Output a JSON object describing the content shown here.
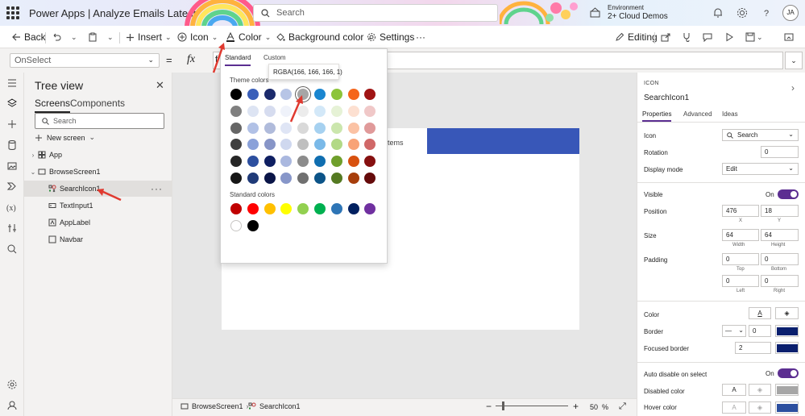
{
  "topbar": {
    "app_name": "Power Apps",
    "separator": "|",
    "doc_title": "Analyze Emails Latest",
    "search_placeholder": "Search",
    "environment_label": "Environment",
    "environment_value": "2+ Cloud Demos",
    "avatar_initials": "JA"
  },
  "commandbar": {
    "back": "Back",
    "insert": "Insert",
    "icon": "Icon",
    "color": "Color",
    "background_color": "Background color",
    "settings": "Settings",
    "more": "···",
    "editing": "Editing"
  },
  "formulabar": {
    "property": "OnSelect",
    "equals": "=",
    "fx": "fx",
    "formula_text": "f"
  },
  "treeview": {
    "title": "Tree view",
    "tabs": [
      "Screens",
      "Components"
    ],
    "search_placeholder": "Search",
    "new_screen": "New screen",
    "items": [
      {
        "label": "App"
      },
      {
        "label": "BrowseScreen1"
      },
      {
        "label": "SearchIcon1"
      },
      {
        "label": "TextInput1"
      },
      {
        "label": "AppLabel"
      },
      {
        "label": "Navbar"
      }
    ],
    "more": "···"
  },
  "canvas": {
    "items_text": "tems"
  },
  "color_popup": {
    "tab_standard": "Standard",
    "tab_custom": "Custom",
    "tooltip": "RGBA(166, 166, 166, 1)",
    "theme_label": "Theme colors",
    "standard_label": "Standard colors",
    "theme_colors": [
      [
        "#000000",
        "#3a5fb9",
        "#1b2a6b",
        "#b7c5e6",
        "#a6a6a6",
        "#1a86d0",
        "#8cc43a",
        "#f5651b",
        "#a01414"
      ],
      [
        "#808080",
        "#dde4f3",
        "#d6dcef",
        "#eff2fa",
        "#ececec",
        "#d3e8f8",
        "#e6f2d6",
        "#fde0d1",
        "#f0c8c8"
      ],
      [
        "#666666",
        "#b1c1e6",
        "#b0bbdb",
        "#dfe5f5",
        "#d9d9d9",
        "#a6d1f0",
        "#cbe6ad",
        "#fbc2a4",
        "#e09a9a"
      ],
      [
        "#404040",
        "#8aa1d9",
        "#8795c7",
        "#cfd8ef",
        "#bfbfbf",
        "#7ab9e8",
        "#b2d986",
        "#f8a377",
        "#d06868"
      ],
      [
        "#262626",
        "#2c4f9f",
        "#0f1f62",
        "#aab8df",
        "#8c8c8c",
        "#106eb0",
        "#6f9f2c",
        "#d8510f",
        "#861010"
      ],
      [
        "#171717",
        "#1f3a78",
        "#0a1547",
        "#8796c9",
        "#707070",
        "#0c5488",
        "#557a22",
        "#a73e0b",
        "#650b0b"
      ]
    ],
    "standard_colors": [
      [
        "#c00000",
        "#ff0000",
        "#ffc000",
        "#ffff00",
        "#92d050",
        "#00b050",
        "#2e75b6",
        "#002060",
        "#7030a0"
      ],
      [
        "#ffffff",
        "#000000"
      ]
    ]
  },
  "statusbar": {
    "screen": "BrowseScreen1",
    "control": "SearchIcon1",
    "zoom_minus": "−",
    "zoom_plus": "+",
    "zoom_value": "50",
    "zoom_unit": "%"
  },
  "properties": {
    "kind": "ICON",
    "name": "SearchIcon1",
    "tabs": [
      "Properties",
      "Advanced",
      "Ideas"
    ],
    "icon_label": "Icon",
    "icon_value": "Search",
    "rotation_label": "Rotation",
    "rotation_value": "0",
    "display_mode_label": "Display mode",
    "display_mode_value": "Edit",
    "visible_label": "Visible",
    "visible_state": "On",
    "position_label": "Position",
    "position_x": "476",
    "position_y": "18",
    "x_label": "X",
    "y_label": "Y",
    "size_label": "Size",
    "size_w": "64",
    "size_h": "64",
    "width_label": "Width",
    "height_label": "Height",
    "padding_label": "Padding",
    "padding_top": "0",
    "padding_bottom": "0",
    "padding_left": "0",
    "padding_right": "0",
    "top_label": "Top",
    "bottom_label": "Bottom",
    "left_label": "Left",
    "right_label": "Right",
    "color_label": "Color",
    "color_glyph": "A",
    "border_label": "Border",
    "border_width": "0",
    "focused_border_label": "Focused border",
    "focused_border_width": "2",
    "auto_disable_label": "Auto disable on select",
    "auto_disable_state": "On",
    "disabled_color_label": "Disabled color",
    "hover_color_label": "Hover color",
    "colors": {
      "border_swatch": "#0a1f6e",
      "focused_swatch": "#0a1f6e",
      "disabled_swatch": "#a6a6a6",
      "hover_swatch": "#2c4f9f",
      "accent": "#5c2e91"
    }
  }
}
